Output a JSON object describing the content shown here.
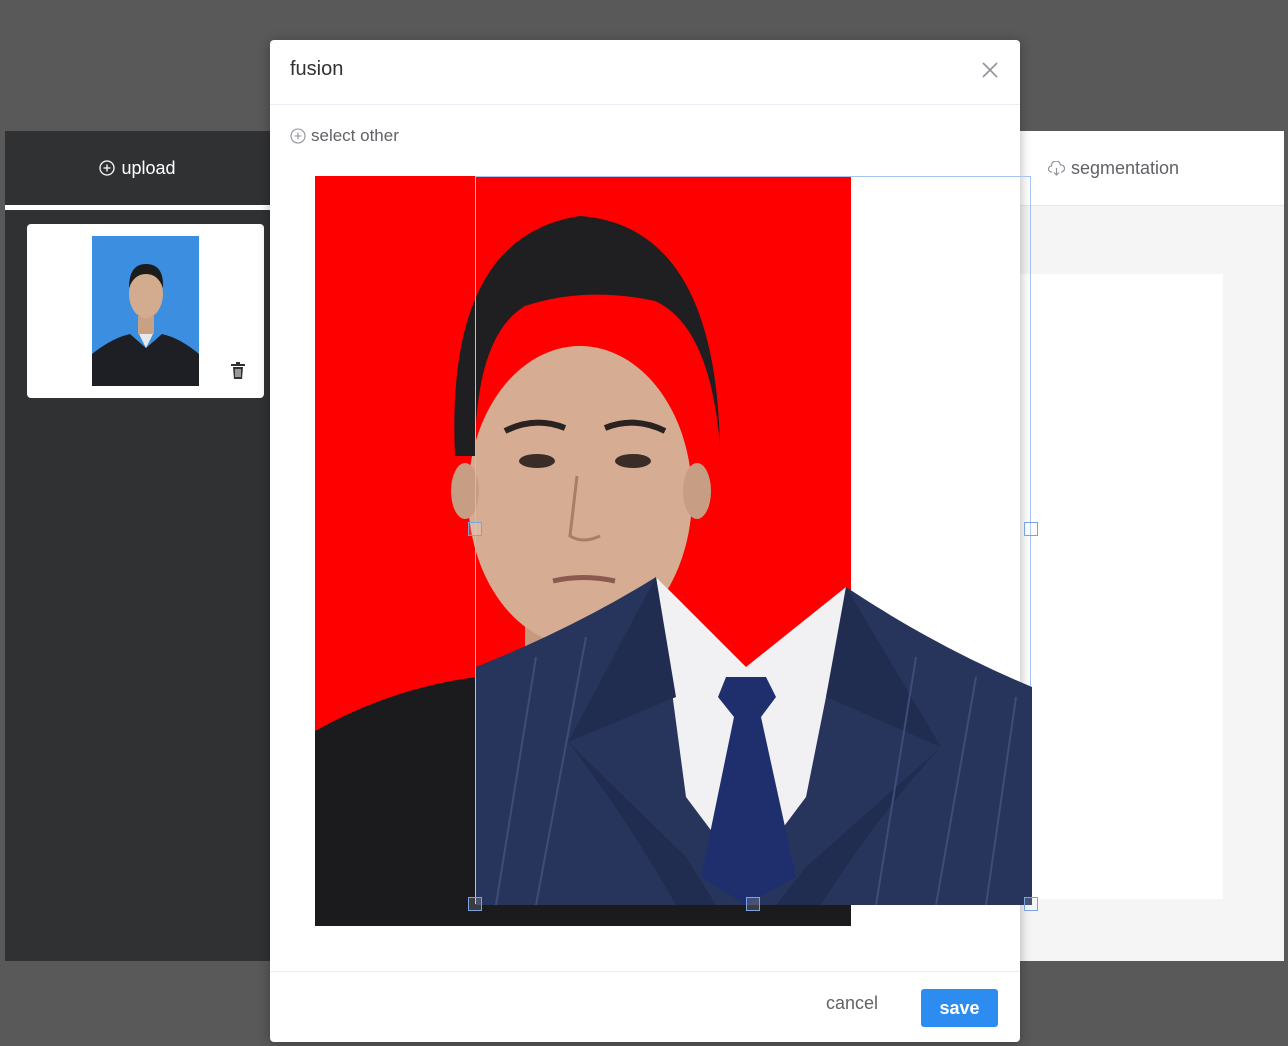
{
  "background_app": {
    "upload_label": "upload",
    "segmentation_label": "segmentation"
  },
  "dialog": {
    "title": "fusion",
    "select_other_label": "select other",
    "cancel_label": "cancel",
    "save_label": "save"
  },
  "colors": {
    "photo_background": "#ff0000",
    "thumb_background": "#3b8ee0",
    "primary_button": "#2d8cf0",
    "suit": "#27355c"
  },
  "icons": {
    "upload": "plus-circle-icon",
    "segmentation": "cloud-download-icon",
    "select_other": "plus-circle-icon",
    "delete": "trash-icon",
    "close": "close-icon"
  }
}
